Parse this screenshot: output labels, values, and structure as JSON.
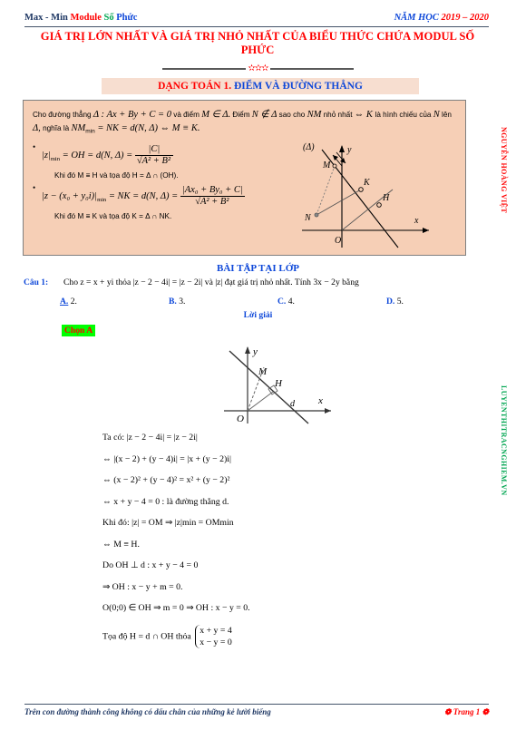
{
  "header": {
    "left_part1": "Max - Min ",
    "left_part2": "Module ",
    "left_part3": "Số ",
    "left_part4": "Phức",
    "right_part1": "NĂM HỌC ",
    "right_part2": "2019 – 2020"
  },
  "doc_title": "GIÁ TRỊ LỚN NHẤT VÀ GIÁ TRỊ NHỎ NHẤT CỦA BIỂU THỨC CHỨA MODUL SỐ PHỨC",
  "stars": "✫✫✫",
  "banner": {
    "prefix": "DẠNG TOÁN 1. ",
    "suffix": "ĐIỂM VÀ ĐƯỜNG THẲNG"
  },
  "theory": {
    "intro_1": "Cho đường thẳng ",
    "intro_delta": "Δ : Ax + By + C = 0",
    "intro_2": " và điểm ",
    "intro_M": "M ∈ Δ.",
    "intro_3": " Điểm ",
    "intro_N": "N ∉ Δ",
    "intro_4": " sao cho ",
    "intro_NM": "NM",
    "intro_5": " nhỏ nhất ",
    "intro_iff": "⇔",
    "intro_K": " K ",
    "intro_6": "là hình chiếu của ",
    "intro_N2": "N",
    "intro_7": " lên ",
    "intro_delta2": "Δ,",
    "intro_8": " nghĩa là ",
    "intro_eq": "NM",
    "intro_sub": "min",
    "intro_eq2": " = NK = d(N, Δ) ⇔ M ≡ K.",
    "bullet1_lhs": "|z|",
    "bullet1_sub": "min",
    "bullet1_mid": " = OH = d(N, Δ) = ",
    "bullet1_num": "|C|",
    "bullet1_den_sqrt": "A² + B²",
    "bullet1_note": "Khi đó M ≡ H và tọa độ H = Δ ∩ (OH).",
    "bullet2_lhs": "|z − (x₀ + y₀i)|",
    "bullet2_sub": "min",
    "bullet2_mid": " = NK = d(N, Δ) = ",
    "bullet2_num": "|Ax₀ + By₀ + C|",
    "bullet2_den_sqrt": "A² + B²",
    "bullet2_note": "Khi đó M ≡ K và tọa độ K = Δ ∩ NK.",
    "diagram_labels": {
      "delta": "(Δ)",
      "y": "y",
      "x": "x",
      "O": "O",
      "M": "M",
      "N": "N",
      "K": "K",
      "H": "H"
    }
  },
  "exercises_title": "BÀI TẬP TẠI LỚP",
  "question": {
    "label": "Câu 1:",
    "text": "Cho z = x + yi thỏa |z − 2 − 4i| = |z − 2i| và |z| đạt giá trị nhỏ nhất. Tính 3x − 2y bằng",
    "choices": [
      {
        "key": "A.",
        "value": "2.",
        "selected": true
      },
      {
        "key": "B.",
        "value": "3.",
        "selected": false
      },
      {
        "key": "C.",
        "value": "4.",
        "selected": false
      },
      {
        "key": "D.",
        "value": "5.",
        "selected": false
      }
    ],
    "solution_heading": "Lời giải",
    "chosen": "Chọn A"
  },
  "diagram2_labels": {
    "y": "y",
    "x": "x",
    "O": "O",
    "M": "M",
    "H": "H",
    "d": "d"
  },
  "solution_steps": [
    "Ta có: |z − 2 − 4i| = |z − 2i|",
    "⇔ |(x − 2) + (y − 4)i| = |x + (y − 2)i|",
    "⇔ (x − 2)² + (y − 4)² = x² + (y − 2)²",
    "⇔ x + y − 4 = 0 : là đường thẳng d.",
    "Khi đó: |z| = OM ⇒ |z|min = OMmin",
    "⇔ M ≡ H.",
    "Do OH ⊥ d : x + y − 4 = 0",
    "⇒ OH : x − y + m = 0.",
    "O(0;0) ∈ OH ⇒ m = 0 ⇒ OH : x − y = 0."
  ],
  "last_step": {
    "prefix": "Tọa độ H = d ∩ OH thỏa",
    "sys_line1": "x + y = 4",
    "sys_line2": "x − y = 0"
  },
  "side_text": {
    "red": "NGUYỄN HOÀNG VIỆT",
    "green": "LUYENTHITRACNGHIEM.VN"
  },
  "footer": {
    "left": "Trên con đường thành công không có dấu chân của những kẻ lười biếng",
    "right": "Trang 1",
    "ornament": "❁"
  },
  "colors": {
    "title_red": "#ff0000",
    "header_navy": "#1f3864",
    "blue": "#0d47d9",
    "green": "#00a651",
    "box_fill": "#f6cfb6",
    "banner_fill": "#f7ded0",
    "highlight": "#00ff00"
  }
}
